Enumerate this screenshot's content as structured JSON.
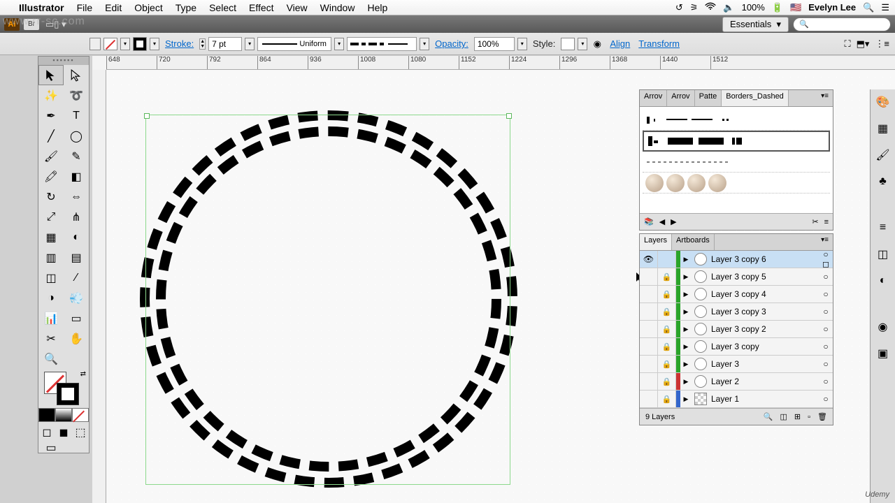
{
  "menubar": {
    "app": "Illustrator",
    "items": [
      "File",
      "Edit",
      "Object",
      "Type",
      "Select",
      "Effect",
      "View",
      "Window",
      "Help"
    ],
    "battery": "100%",
    "user": "Evelyn Lee"
  },
  "appbar": {
    "workspace": "Essentials",
    "search_ph": ""
  },
  "ctrl": {
    "stroke_lbl": "Stroke:",
    "stroke_val": "7 pt",
    "profile": "Uniform",
    "opacity_lbl": "Opacity:",
    "opacity_val": "100%",
    "style_lbl": "Style:",
    "align": "Align",
    "transform": "Transform"
  },
  "ruler": [
    "648",
    "720",
    "792",
    "864",
    "936",
    "1008",
    "1080",
    "1152",
    "1224",
    "1296",
    "1368",
    "1440",
    "1512"
  ],
  "brushes": {
    "tabs": [
      "Arrov",
      "Arrov",
      "Patte",
      "Borders_Dashed"
    ],
    "active": 3
  },
  "layersPanel": {
    "tabs": [
      "Layers",
      "Artboards"
    ],
    "active": 0,
    "count": "9 Layers",
    "rows": [
      {
        "name": "Layer 3 copy 6",
        "vis": true,
        "lock": false,
        "color": "#2aa52a",
        "sel": true,
        "target": true
      },
      {
        "name": "Layer 3 copy 5",
        "vis": false,
        "lock": true,
        "color": "#2aa52a",
        "sel": false,
        "target": false
      },
      {
        "name": "Layer 3 copy 4",
        "vis": false,
        "lock": true,
        "color": "#2aa52a",
        "sel": false,
        "target": false
      },
      {
        "name": "Layer 3 copy 3",
        "vis": false,
        "lock": true,
        "color": "#2aa52a",
        "sel": false,
        "target": false
      },
      {
        "name": "Layer 3 copy 2",
        "vis": false,
        "lock": true,
        "color": "#2aa52a",
        "sel": false,
        "target": false
      },
      {
        "name": "Layer 3 copy",
        "vis": false,
        "lock": true,
        "color": "#2aa52a",
        "sel": false,
        "target": false
      },
      {
        "name": "Layer 3",
        "vis": false,
        "lock": true,
        "color": "#2aa52a",
        "sel": false,
        "target": false
      },
      {
        "name": "Layer 2",
        "vis": false,
        "lock": true,
        "color": "#cc3333",
        "sel": false,
        "target": false
      },
      {
        "name": "Layer 1",
        "vis": false,
        "lock": true,
        "color": "#3366cc",
        "sel": false,
        "target": false,
        "sq": true
      }
    ]
  },
  "watermark": "www.rr-sc.com",
  "udemy": "Udemy"
}
